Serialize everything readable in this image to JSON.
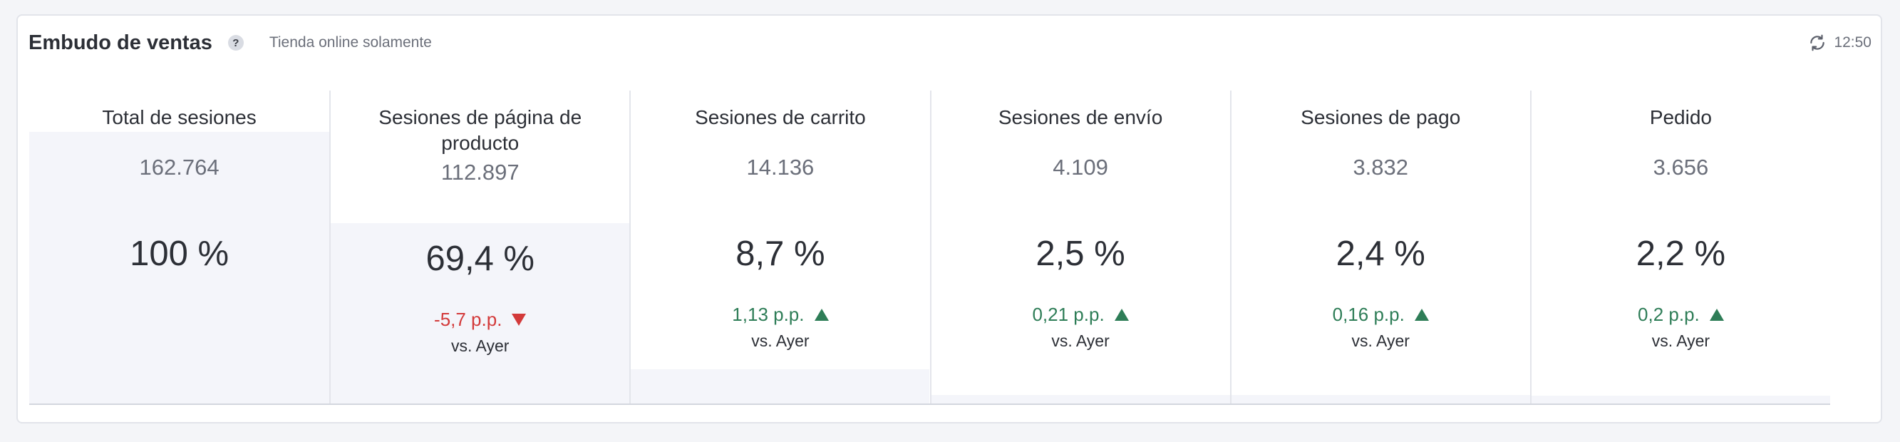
{
  "header": {
    "title": "Embudo de ventas",
    "help_symbol": "?",
    "subtitle": "Tienda online solamente",
    "updated_time": "12:50",
    "refresh_icon": "refresh-icon"
  },
  "colors": {
    "positive": "#2e7d57",
    "negative": "#d33a3a",
    "bar_fill": "#f4f5fa"
  },
  "chart_data": {
    "type": "bar",
    "categories": [
      "Total de sesiones",
      "Sesiones de página de producto",
      "Sesiones de carrito",
      "Sesiones de envío",
      "Sesiones de pago",
      "Pedido"
    ],
    "values": [
      100,
      69.4,
      8.7,
      2.5,
      2.4,
      2.2
    ],
    "ylim": [
      0,
      100
    ]
  },
  "stages": [
    {
      "title": "Total de sesiones",
      "count": "162.764",
      "percent": "100 %",
      "delta": "",
      "direction": "",
      "comparison": "",
      "fill_fraction": 1.0
    },
    {
      "title": "Sesiones de página de producto",
      "count": "112.897",
      "percent": "69,4 %",
      "delta": "-5,7 p.p.",
      "direction": "down",
      "comparison": "vs. Ayer",
      "fill_fraction": 0.694
    },
    {
      "title": "Sesiones de carrito",
      "count": "14.136",
      "percent": "8,7 %",
      "delta": "1,13 p.p.",
      "direction": "up",
      "comparison": "vs. Ayer",
      "fill_fraction": 0.087
    },
    {
      "title": "Sesiones de envío",
      "count": "4.109",
      "percent": "2,5 %",
      "delta": "0,21 p.p.",
      "direction": "up",
      "comparison": "vs. Ayer",
      "fill_fraction": 0.025
    },
    {
      "title": "Sesiones de pago",
      "count": "3.832",
      "percent": "2,4 %",
      "delta": "0,16 p.p.",
      "direction": "up",
      "comparison": "vs. Ayer",
      "fill_fraction": 0.024
    },
    {
      "title": "Pedido",
      "count": "3.656",
      "percent": "2,2 %",
      "delta": "0,2 p.p.",
      "direction": "up",
      "comparison": "vs. Ayer",
      "fill_fraction": 0.022
    }
  ]
}
